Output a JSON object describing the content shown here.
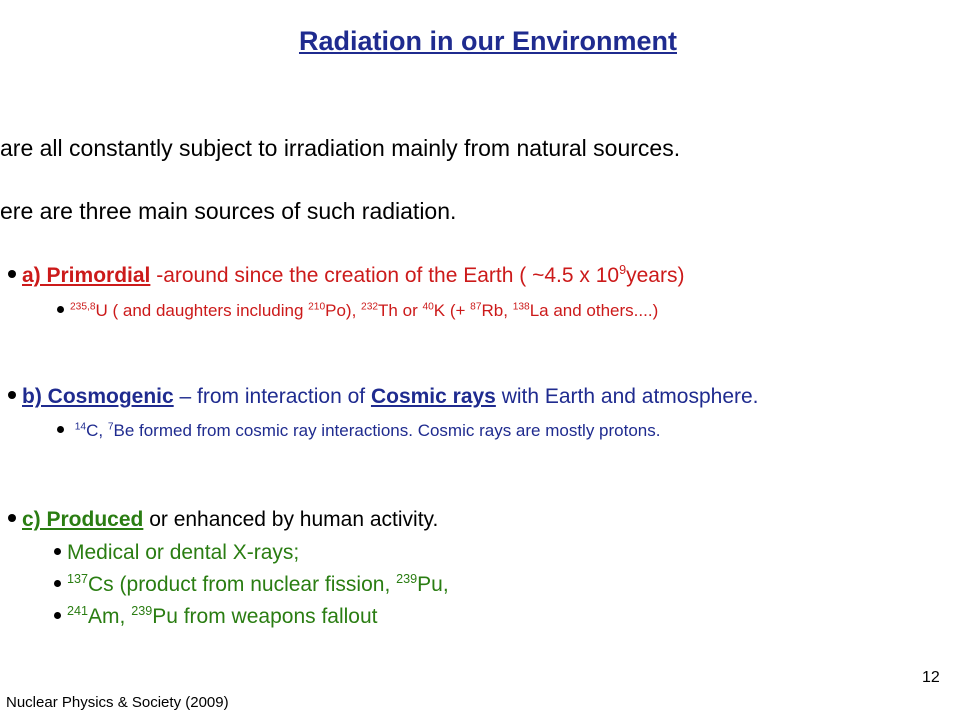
{
  "title": "Radiation in our Environment",
  "intro1": "are all constantly subject to irradiation mainly from natural sources.",
  "intro2": "ere are three main sources of such radiation.",
  "primordial": {
    "label": "a) Primordial",
    "desc_a": " -around since the creation of the Earth ( ",
    "approx": "~",
    "desc_b": "4.5 x 10",
    "exp": "9",
    "desc_c": "years)",
    "sub": {
      "iso1_sup": "235,8",
      "iso1": "U ( and daughters including ",
      "iso2_sup": "210",
      "iso2": "Po), ",
      "iso3_sup": "232",
      "iso3": "Th or ",
      "iso4_sup": "40",
      "iso4": "K (+ ",
      "iso5_sup": "87",
      "iso5": "Rb, ",
      "iso6_sup": "138",
      "iso6": "La and others....)"
    }
  },
  "cosmogenic": {
    "label": "b) Cosmogenic",
    "desc_a": " – from interaction of ",
    "link": "Cosmic rays",
    "desc_b": " with Earth and atmosphere.",
    "sub": {
      "c_sup": "14",
      "c": "C, ",
      "be_sup": "7",
      "be": "Be formed from cosmic ray interactions. Cosmic rays are mostly protons."
    }
  },
  "produced": {
    "label": "c) Produced",
    "desc": "  or enhanced by human activity.",
    "items": {
      "medical": "Medical or dental X-rays;",
      "cs_sup": "137",
      "cs": "Cs (product from nuclear fission, ",
      "pu_sup": "239",
      "pu": "Pu,",
      "am_sup": "241",
      "am": "Am, ",
      "pu2_sup": "239",
      "pu2": "Pu from weapons fallout"
    }
  },
  "footer": "Nuclear Physics & Society (2009)",
  "page_number": "12"
}
